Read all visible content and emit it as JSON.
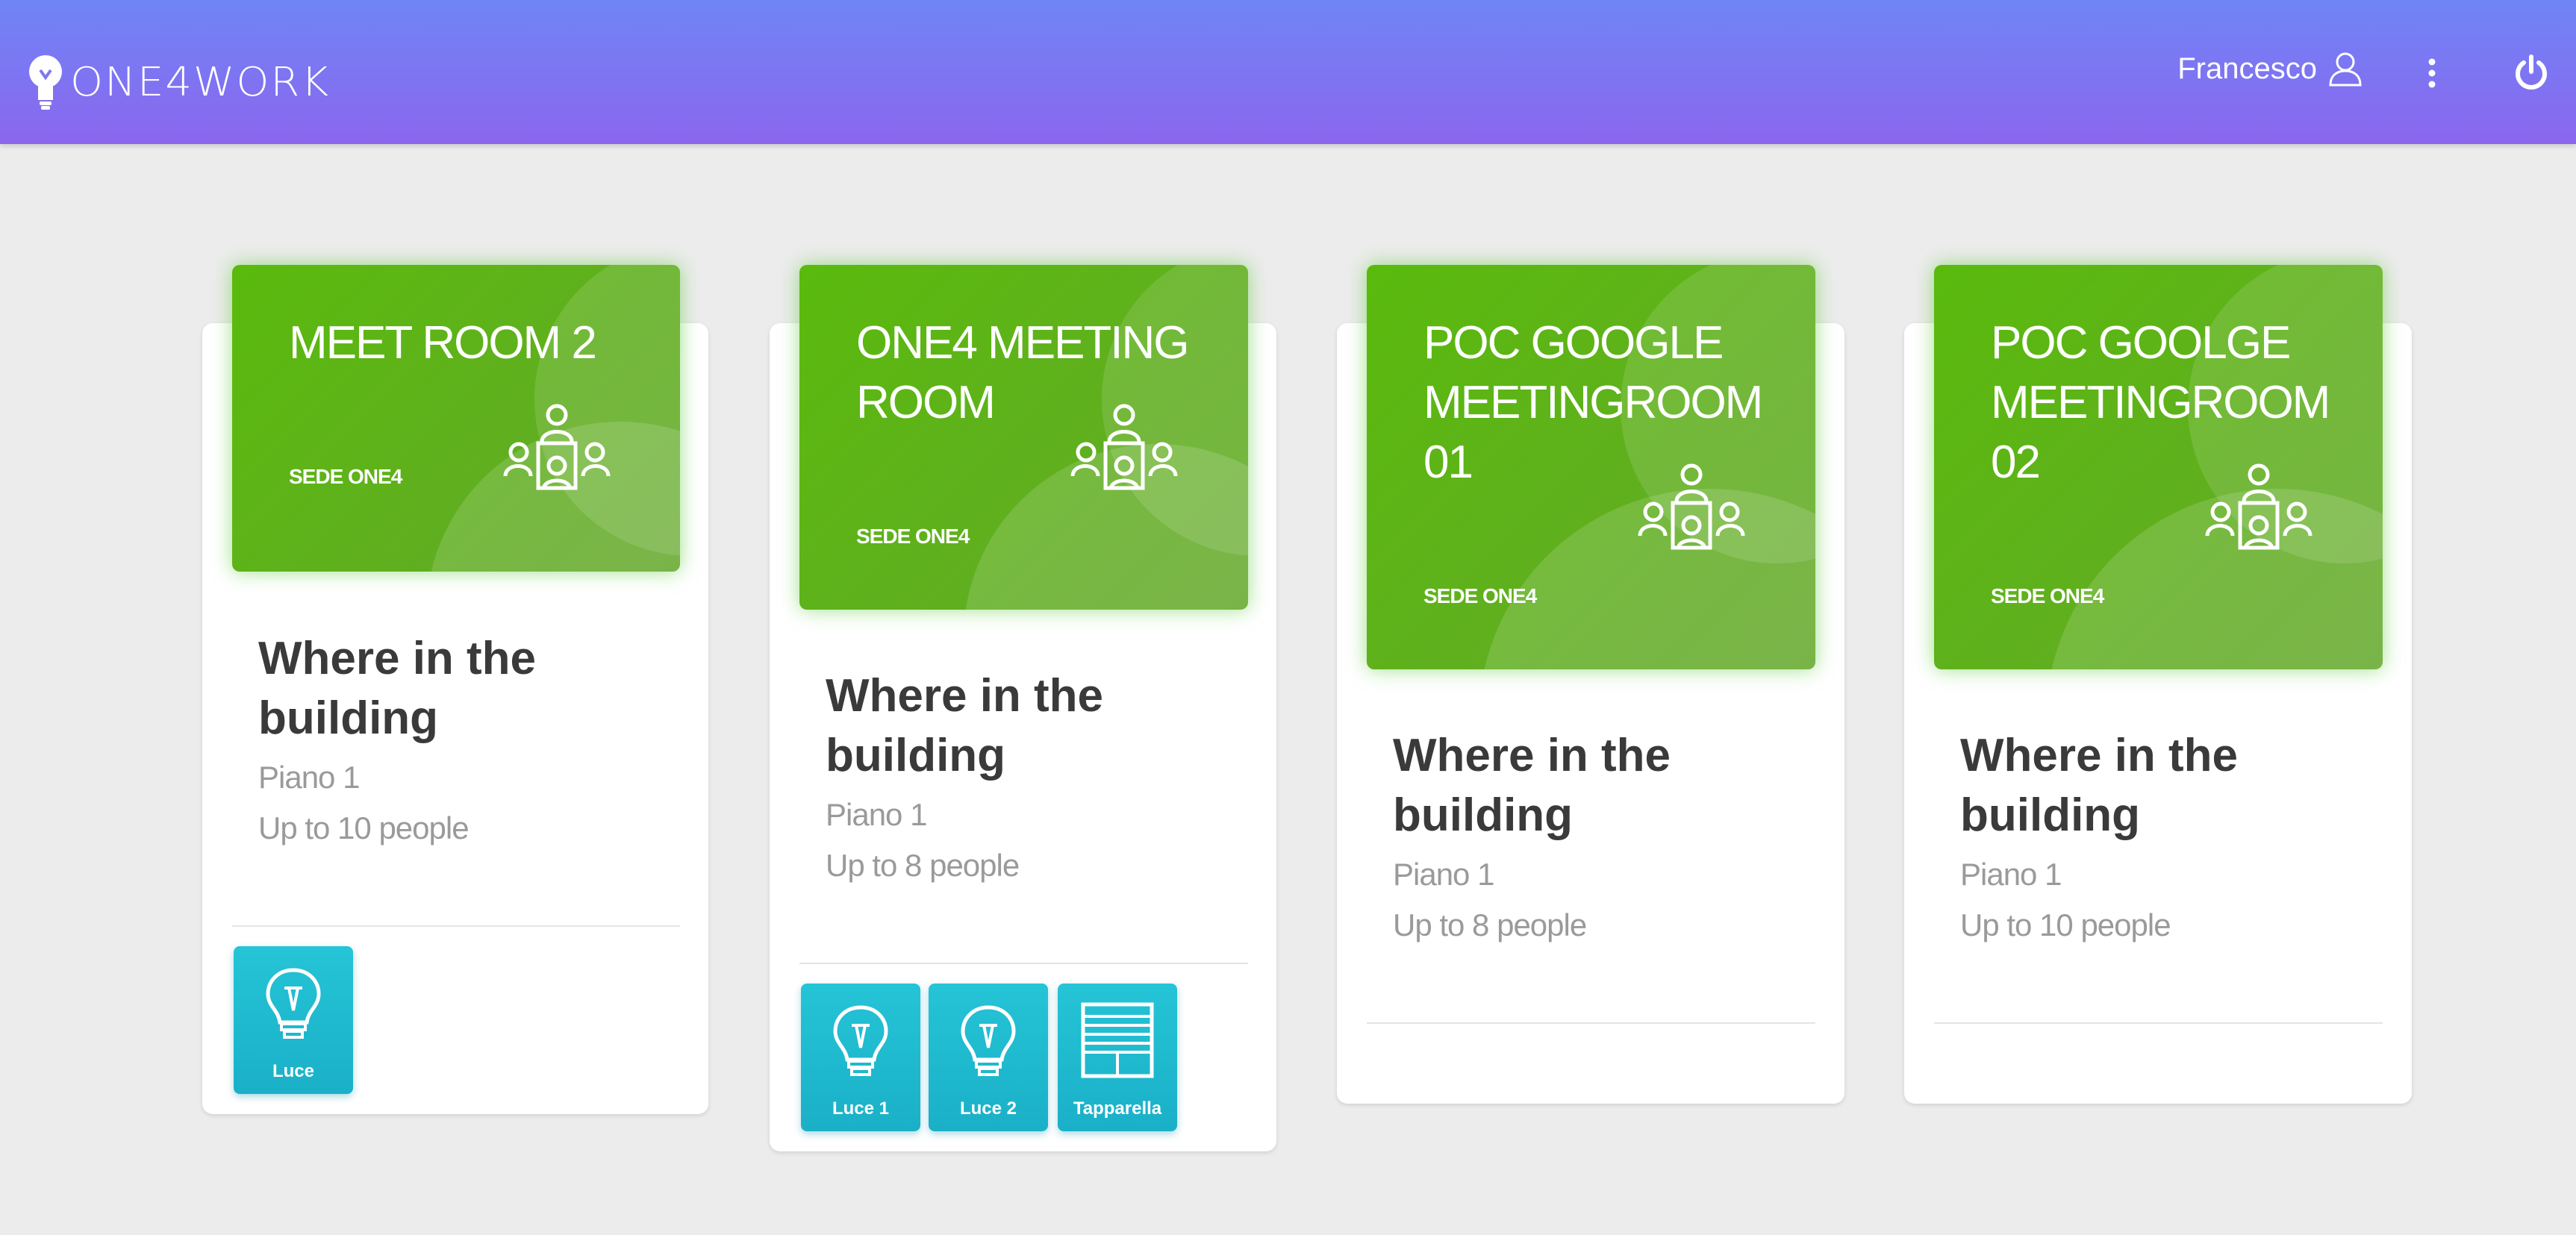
{
  "header": {
    "brand": "ONE4WORK",
    "user_name": "Francesco",
    "icons": [
      "user-icon",
      "more-vert-icon",
      "power-icon"
    ]
  },
  "colors": {
    "header_start": "#6f85f6",
    "header_end": "#8b66ee",
    "banner": "#5aba0c",
    "device": "#25c4d6"
  },
  "rooms": [
    {
      "title": "MEET ROOM 2",
      "site": "SEDE ONE4",
      "where": "Where in the building",
      "floor": "Piano 1",
      "capacity": "Up to 10 people",
      "devices": [
        {
          "label": "Luce",
          "icon": "bulb-icon"
        }
      ]
    },
    {
      "title": "ONE4 MEETING ROOM",
      "site": "SEDE ONE4",
      "where": "Where in the building",
      "floor": "Piano 1",
      "capacity": "Up to 8 people",
      "devices": [
        {
          "label": "Luce 1",
          "icon": "bulb-icon"
        },
        {
          "label": "Luce 2",
          "icon": "bulb-icon"
        },
        {
          "label": "Tapparella",
          "icon": "blind-icon"
        }
      ]
    },
    {
      "title": "POC GOOGLE MEETINGROOM 01",
      "site": "SEDE ONE4",
      "where": "Where in the building",
      "floor": "Piano 1",
      "capacity": "Up to 8 people",
      "devices": []
    },
    {
      "title": "POC GOOLGE MEETINGROOM 02",
      "site": "SEDE ONE4",
      "where": "Where in the building",
      "floor": "Piano 1",
      "capacity": "Up to 10 people",
      "devices": []
    }
  ]
}
